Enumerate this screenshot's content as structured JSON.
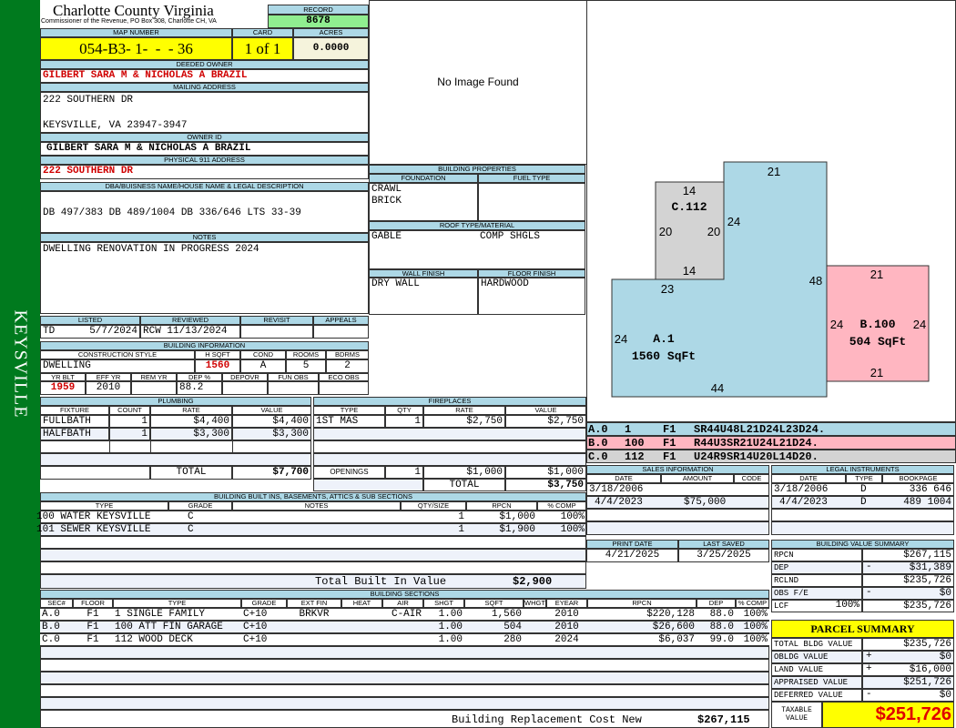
{
  "side_label": "KEYSVILLE",
  "header": {
    "title": "Charlotte County Virginia",
    "subtitle": "Commissioner of the Revenue, PO Box 308, Charlotte CH, VA",
    "record_label": "RECORD",
    "record": "8678",
    "map_label": "MAP NUMBER",
    "map": "054-B3- 1-  -  - 36",
    "card_label": "CARD",
    "card": "1 of 1",
    "acres_label": "ACRES",
    "acres": "0.0000"
  },
  "owner": {
    "deeded_label": "DEEDED OWNER",
    "deeded": "GILBERT SARA M & NICHOLAS A BRAZIL",
    "mailing_label": "MAILING ADDRESS",
    "mail1": "222 SOUTHERN DR",
    "mail2": "KEYSVILLE, VA 23947-3947",
    "id_label": "OWNER ID",
    "id": "GILBERT SARA M & NICHOLAS A BRAZIL",
    "phys_label": "PHYSICAL 911 ADDRESS",
    "phys": "222 SOUTHERN DR",
    "dba_label": "DBA/BUISNESS NAME/HOUSE NAME & LEGAL DESCRIPTION",
    "dba": "DB 497/383 DB 489/1004 DB 336/646 LTS 33-39",
    "notes_label": "NOTES",
    "notes": "DWELLING RENOVATION IN PROGRESS 2024"
  },
  "image_text": "No Image Found",
  "listing": {
    "labels": [
      "LISTED",
      "REVIEWED",
      "REVISIT",
      "APPEALS"
    ],
    "listed_by": "TD",
    "listed": "5/7/2024",
    "reviewed_by": "RCW",
    "reviewed": "11/13/2024"
  },
  "building_info": {
    "title": "BUILDING INFORMATION",
    "labels1": [
      "CONSTRUCTION STYLE",
      "H SQFT",
      "COND",
      "ROOMS",
      "BDRMS"
    ],
    "values1": [
      "DWELLING",
      "1560",
      "A",
      "5",
      "2"
    ],
    "labels2": [
      "YR BLT",
      "EFF YR",
      "REM YR",
      "DEP %",
      "DEPOVR",
      "FUN OBS",
      "ECO OBS"
    ],
    "values2": [
      "1959",
      "2010",
      "",
      "88.2",
      "",
      "",
      ""
    ]
  },
  "properties": {
    "title": "BUILDING PROPERTIES",
    "foundation_label": "FOUNDATION",
    "fuel_label": "FUEL TYPE",
    "foundation": [
      "CRAWL",
      "BRICK"
    ],
    "roof_label": "ROOF TYPE/MATERIAL",
    "roof": "GABLE",
    "roof_material": "COMP SHGLS",
    "wall_label": "WALL FINISH",
    "floor_label": "FLOOR FINISH",
    "wall": "DRY WALL",
    "floor": "HARDWOOD"
  },
  "plumbing": {
    "title": "PLUMBING",
    "cols": [
      "FIXTURE",
      "COUNT",
      "RATE",
      "VALUE"
    ],
    "rows": [
      [
        "FULLBATH",
        "1",
        "$4,400",
        "$4,400"
      ],
      [
        "HALFBATH",
        "1",
        "$3,300",
        "$3,300"
      ]
    ],
    "total_label": "TOTAL",
    "total": "$7,700"
  },
  "fireplaces": {
    "title": "FIREPLACES",
    "cols": [
      "TYPE",
      "QTY",
      "RATE",
      "VALUE"
    ],
    "rows": [
      [
        "1ST MAS",
        "1",
        "$2,750",
        "$2,750"
      ]
    ],
    "openings_label": "OPENINGS",
    "openings": [
      "1",
      "$1,000",
      "$1,000"
    ],
    "total_label": "TOTAL",
    "total": "$3,750"
  },
  "builtins": {
    "title": "BUILDING BUILT INS, BASEMENTS, ATTICS & SUB SECTIONS",
    "cols": [
      "TYPE",
      "GRADE",
      "NOTES",
      "QTY/SIZE",
      "RPCN",
      "% COMP"
    ],
    "rows": [
      [
        "100 WATER KEYSVILLE",
        "C",
        "",
        "1",
        "$1,000",
        "100%"
      ],
      [
        "101 SEWER KEYSVILLE",
        "C",
        "",
        "1",
        "$1,900",
        "100%"
      ]
    ],
    "total_label": "Total Built In Value",
    "total": "$2,900"
  },
  "sections": {
    "title": "BUILDING SECTIONS",
    "cols": [
      "SEC#",
      "FLOOR",
      "TYPE",
      "GRADE",
      "EXT FIN",
      "HEAT",
      "AIR",
      "SHGT",
      "SQFT",
      "WHGT",
      "EYEAR",
      "RPCN",
      "DEP",
      "% COMP"
    ],
    "rows": [
      [
        "A.0",
        "F1",
        "1 SINGLE FAMILY",
        "C+10",
        "BRKVR",
        "",
        "C-AIR",
        "1.00",
        "1,560",
        "",
        "2010",
        "$220,128",
        "88.0",
        "100%"
      ],
      [
        "B.0",
        "F1",
        "100 ATT FIN GARAGE",
        "C+10",
        "",
        "",
        "",
        "1.00",
        "504",
        "",
        "2010",
        "$26,600",
        "88.0",
        "100%"
      ],
      [
        "C.0",
        "F1",
        "112 WOOD DECK",
        "C+10",
        "",
        "",
        "",
        "1.00",
        "280",
        "",
        "2024",
        "$6,037",
        "99.0",
        "100%"
      ]
    ],
    "total_label": "Building Replacement Cost New",
    "total": "$267,115"
  },
  "sketch": {
    "a_label": "A.1",
    "a_area": "1560 SqFt",
    "b_label": "B.100",
    "b_area": "504 SqFt",
    "c_label": "C.112",
    "a_dims": [
      "21",
      "24",
      "48",
      "23",
      "24",
      "44"
    ],
    "b_dims": [
      "21",
      "24",
      "24",
      "21"
    ],
    "c_dims": [
      "14",
      "20",
      "20",
      "14"
    ],
    "colors": {
      "A": "#add8e6",
      "B": "#ffb6c1",
      "C": "#d3d3d3"
    },
    "legend": [
      [
        "A.0",
        "1",
        "F1",
        "SR44U48L21D24L23D24."
      ],
      [
        "B.0",
        "100",
        "F1",
        "R44U3SR21U24L21D24."
      ],
      [
        "C.0",
        "112",
        "F1",
        "U24R9SR14U20L14D20."
      ]
    ]
  },
  "sales": {
    "title": "SALES INFORMATION",
    "cols": [
      "DATE",
      "AMOUNT",
      "CODE"
    ],
    "rows": [
      [
        "3/18/2006",
        "",
        ""
      ],
      [
        "4/4/2023",
        "$75,000",
        ""
      ]
    ]
  },
  "legal": {
    "title": "LEGAL INSTRUMENTS",
    "cols": [
      "DATE",
      "TYPE",
      "BOOKPAGE"
    ],
    "rows": [
      [
        "3/18/2006",
        "D",
        "336 646"
      ],
      [
        "4/4/2023",
        "D",
        "489 1004"
      ]
    ]
  },
  "dates": {
    "print_label": "PRINT DATE",
    "print": "4/21/2025",
    "saved_label": "LAST SAVED",
    "saved": "3/25/2025"
  },
  "value_summary": {
    "title": "BUILDING VALUE SUMMARY",
    "rows": [
      [
        "RPCN",
        "",
        "",
        "$267,115"
      ],
      [
        "DEP",
        "",
        "-",
        "$31,389"
      ],
      [
        "RCLND",
        "",
        "",
        "$235,726"
      ],
      [
        "OBS F/E",
        "",
        "-",
        "$0"
      ],
      [
        "LCF",
        "100%",
        "",
        "$235,726"
      ]
    ]
  },
  "parcel": {
    "title": "PARCEL SUMMARY",
    "rows": [
      [
        "TOTAL BLDG VALUE",
        "",
        "$235,726"
      ],
      [
        "OBLDG VALUE",
        "+",
        "$0"
      ],
      [
        "LAND VALUE",
        "+",
        "$16,000"
      ],
      [
        "APPRAISED VALUE",
        "",
        "$251,726"
      ],
      [
        "DEFERRED VALUE",
        "-",
        "$0"
      ]
    ],
    "taxable_label": "TAXABLE VALUE",
    "taxable": "$251,726"
  }
}
